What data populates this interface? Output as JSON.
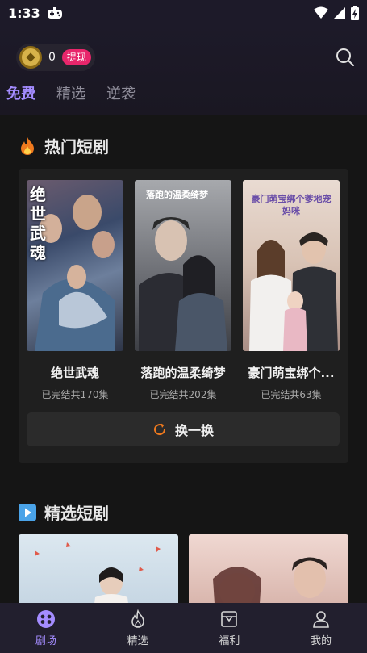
{
  "status_bar": {
    "time": "1:33"
  },
  "header": {
    "coin_count": "0",
    "withdraw_label": "提现",
    "tabs": [
      {
        "label": "免费",
        "active": true
      },
      {
        "label": "精选",
        "active": false
      },
      {
        "label": "逆袭",
        "active": false
      }
    ]
  },
  "hot_section": {
    "title": "热门短剧",
    "items": [
      {
        "name": "绝世武魂",
        "episodes": "已完结共170集",
        "cover_title": "绝世武魂"
      },
      {
        "name": "落跑的温柔绮梦",
        "episodes": "已完结共202集",
        "cover_title": "落跑的温柔绮梦"
      },
      {
        "name": "豪门萌宝绑个...",
        "episodes": "已完结共63集",
        "cover_title": "豪门萌宝绑个爹地宠妈咪"
      }
    ],
    "refresh_label": "换一换"
  },
  "featured_section": {
    "title": "精选短剧"
  },
  "bottom_nav": [
    {
      "label": "剧场",
      "icon": "theater-icon",
      "active": true
    },
    {
      "label": "精选",
      "icon": "flame-icon",
      "active": false
    },
    {
      "label": "福利",
      "icon": "gift-box-icon",
      "active": false
    },
    {
      "label": "我的",
      "icon": "profile-icon",
      "active": false
    }
  ],
  "colors": {
    "accent": "#a48cff",
    "withdraw": "#e8266b",
    "background": "#151515"
  }
}
